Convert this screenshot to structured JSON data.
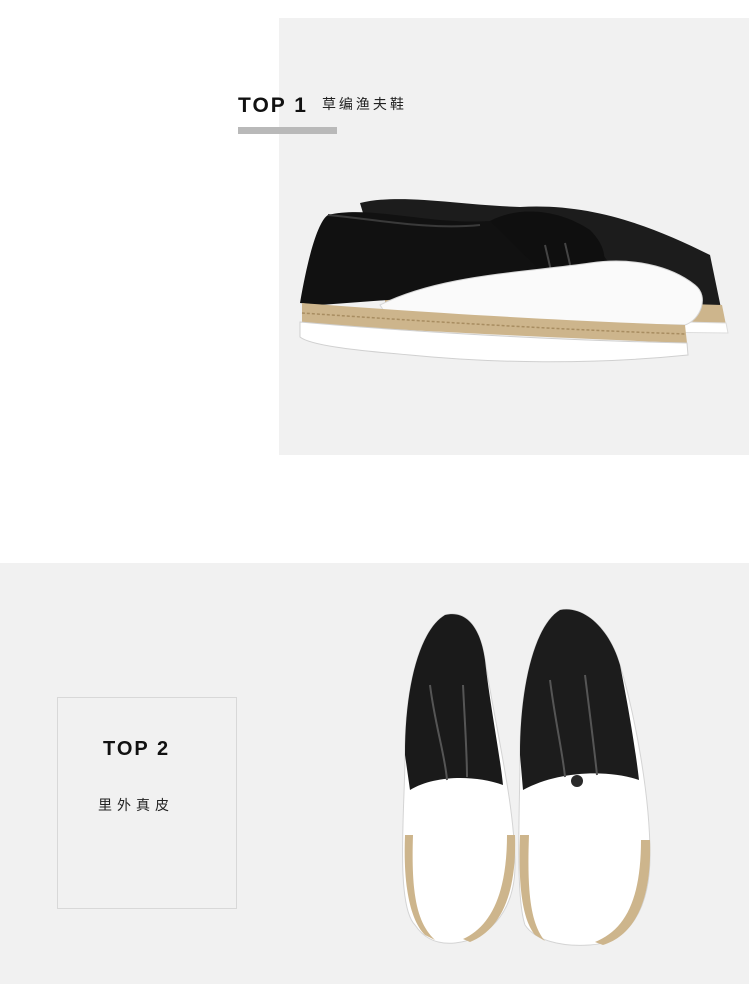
{
  "section1": {
    "rank_label": "TOP 1",
    "feature_text": "草编渔夫鞋",
    "image_subject": "black-and-white slip-on espadrille shoe pair, side view"
  },
  "section2": {
    "rank_label": "TOP 2",
    "feature_text": "里外真皮",
    "image_subject": "black-and-white slip-on espadrille shoe pair, top view"
  },
  "colors": {
    "panel_bg": "#f1f1f1",
    "accent_bar": "#b9b9b9",
    "box_border": "#d8d8d8",
    "text": "#111111",
    "jute": "#cdb58c"
  }
}
